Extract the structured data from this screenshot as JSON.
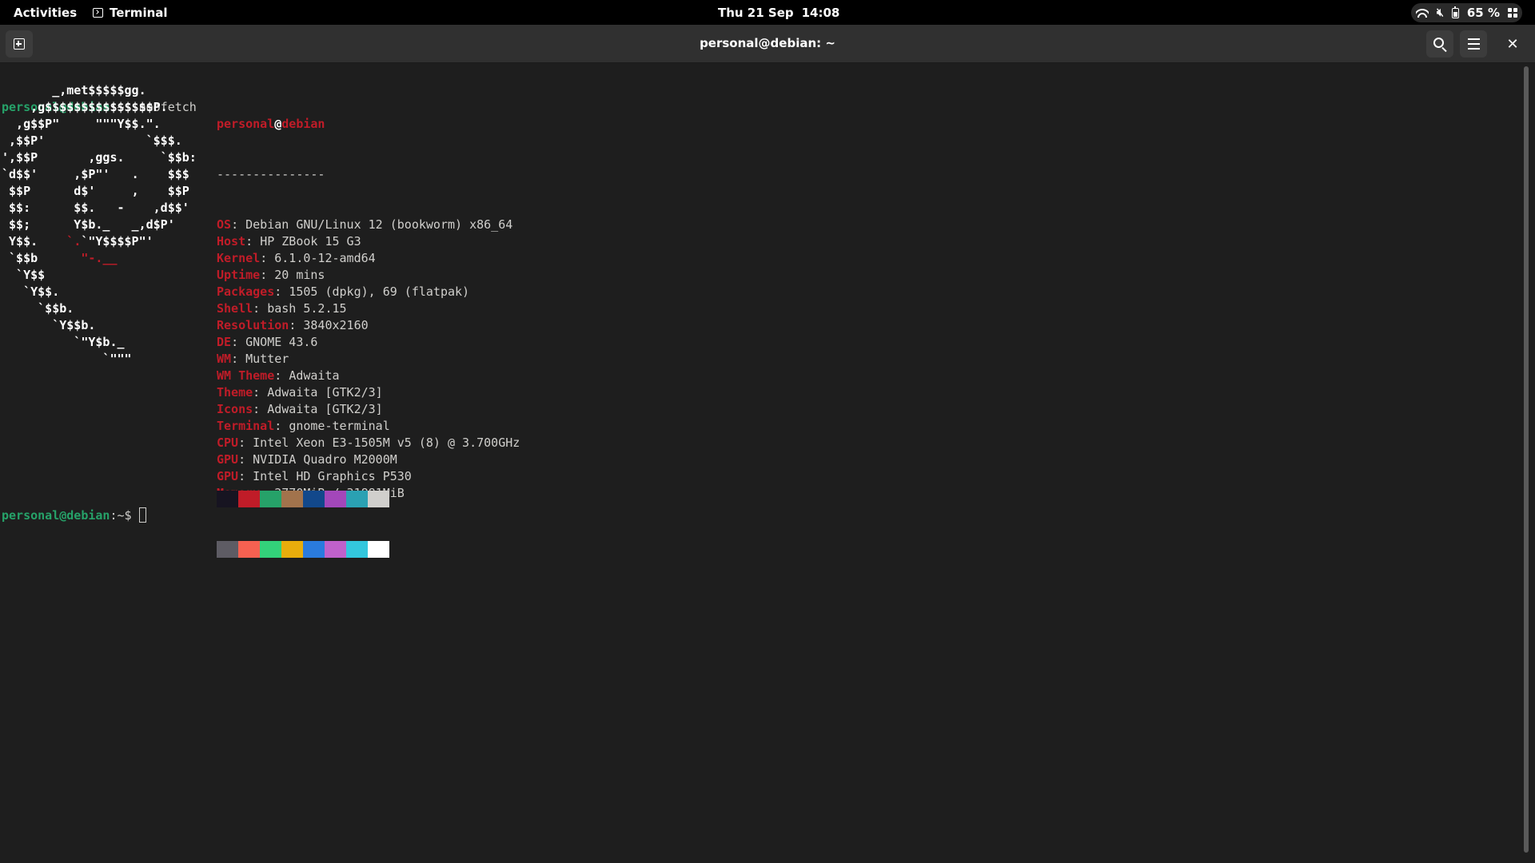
{
  "topbar": {
    "activities": "Activities",
    "app_name": "Terminal",
    "date": "Thu 21 Sep",
    "time": "14:08",
    "battery": "65 %"
  },
  "window": {
    "title": "personal@debian: ~"
  },
  "terminal": {
    "prompt_user": "personal@debian",
    "prompt_suffix": ":~",
    "prompt_symbol": "$ ",
    "command": "neofetch",
    "art_lines": [
      "       _,met$$$$$gg.",
      "    ,g$$$$$$$$$$$$$$$P.",
      "  ,g$$P\"     \"\"\"Y$$.\".",
      " ,$$P'              `$$$.",
      "',$$P       ,ggs.     `$$b:",
      "`d$$'     ,$P\"'   .    $$$",
      " $$P      d$'     ,    $$P",
      " $$:      $$.   -    ,d$$'",
      " $$;      Y$b._   _,d$P'",
      " Y$$.    `.`\"Y$$$$P\"'",
      " `$$b      \"-.__",
      "  `Y$$",
      "   `Y$$.",
      "     `$$b.",
      "       `Y$$b.",
      "          `\"Y$b._",
      "              `\"\"\""
    ],
    "info_user": "personal",
    "info_at": "@",
    "info_host": "debian",
    "separator": "---------------",
    "info": [
      {
        "key": "OS",
        "value": "Debian GNU/Linux 12 (bookworm) x86_64"
      },
      {
        "key": "Host",
        "value": "HP ZBook 15 G3"
      },
      {
        "key": "Kernel",
        "value": "6.1.0-12-amd64"
      },
      {
        "key": "Uptime",
        "value": "20 mins"
      },
      {
        "key": "Packages",
        "value": "1505 (dpkg), 69 (flatpak)"
      },
      {
        "key": "Shell",
        "value": "bash 5.2.15"
      },
      {
        "key": "Resolution",
        "value": "3840x2160"
      },
      {
        "key": "DE",
        "value": "GNOME 43.6"
      },
      {
        "key": "WM",
        "value": "Mutter"
      },
      {
        "key": "WM Theme",
        "value": "Adwaita"
      },
      {
        "key": "Theme",
        "value": "Adwaita [GTK2/3]"
      },
      {
        "key": "Icons",
        "value": "Adwaita [GTK2/3]"
      },
      {
        "key": "Terminal",
        "value": "gnome-terminal"
      },
      {
        "key": "CPU",
        "value": "Intel Xeon E3-1505M v5 (8) @ 3.700GHz"
      },
      {
        "key": "GPU",
        "value": "NVIDIA Quadro M2000M"
      },
      {
        "key": "GPU",
        "value": "Intel HD Graphics P530"
      },
      {
        "key": "Memory",
        "value": "2770MiB / 31881MiB"
      }
    ],
    "palette_top": [
      "#171421",
      "#c01c28",
      "#26a269",
      "#a2734c",
      "#12488b",
      "#a347ba",
      "#2aa1b3",
      "#d0cfcc"
    ],
    "palette_bottom": [
      "#5e5c64",
      "#f66151",
      "#33d17a",
      "#e9ad0c",
      "#2a7bde",
      "#c061cb",
      "#33c7de",
      "#ffffff"
    ]
  }
}
